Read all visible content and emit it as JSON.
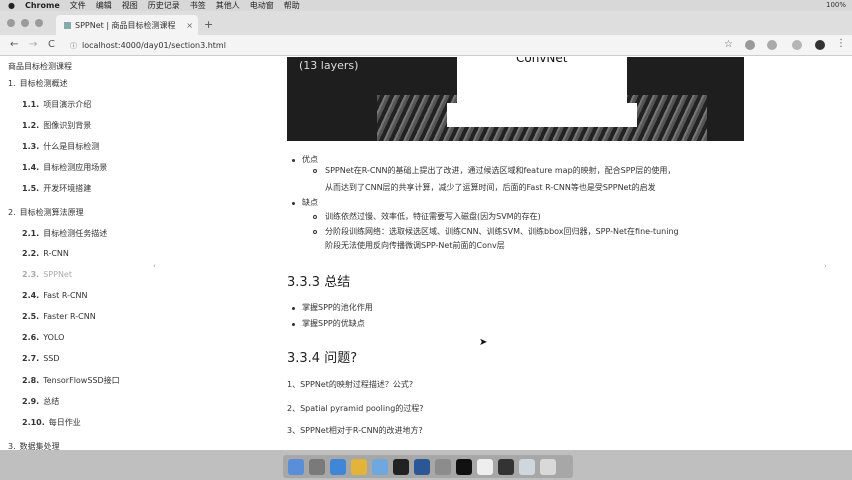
{
  "menubar": {
    "apple": "",
    "items": [
      "Chrome",
      "文件",
      "编辑",
      "视图",
      "历史记录",
      "书签",
      "其他人",
      "电动窗",
      "帮助"
    ],
    "right": [
      "100%"
    ]
  },
  "tab": {
    "title": "SPPNet | 商品目标检测课程",
    "close": "×",
    "new": "+"
  },
  "address": {
    "back": "←",
    "forward": "→",
    "reload": "C",
    "url": "localhost:4000/day01/section3.html",
    "lock": "ⓘ",
    "star": "☆"
  },
  "sidebar": {
    "title": "商品目标检测课程",
    "items": [
      {
        "level": 1,
        "num": "1.",
        "label": "目标检测概述",
        "active": false
      },
      {
        "level": 2,
        "num": "1.1.",
        "label": "项目演示介绍",
        "active": false
      },
      {
        "level": 2,
        "num": "1.2.",
        "label": "图像识别背景",
        "active": false
      },
      {
        "level": 2,
        "num": "1.3.",
        "label": "什么是目标检测",
        "active": false
      },
      {
        "level": 2,
        "num": "1.4.",
        "label": "目标检测应用场景",
        "active": false
      },
      {
        "level": 2,
        "num": "1.5.",
        "label": "开发环境搭建",
        "active": false
      },
      {
        "level": 1,
        "num": "2.",
        "label": "目标检测算法原理",
        "active": false
      },
      {
        "level": 2,
        "num": "2.1.",
        "label": "目标检测任务描述",
        "active": false
      },
      {
        "level": 2,
        "num": "2.2.",
        "label": "R-CNN",
        "active": false
      },
      {
        "level": 2,
        "num": "2.3.",
        "label": "SPPNet",
        "active": true
      },
      {
        "level": 2,
        "num": "2.4.",
        "label": "Fast R-CNN",
        "active": false
      },
      {
        "level": 2,
        "num": "2.5.",
        "label": "Faster R-CNN",
        "active": false
      },
      {
        "level": 2,
        "num": "2.6.",
        "label": "YOLO",
        "active": false
      },
      {
        "level": 2,
        "num": "2.7.",
        "label": "SSD",
        "active": false
      },
      {
        "level": 2,
        "num": "2.8.",
        "label": "TensorFlowSSD接口",
        "active": false
      },
      {
        "level": 2,
        "num": "2.9.",
        "label": "总结",
        "active": false
      },
      {
        "level": 2,
        "num": "2.10.",
        "label": "每日作业",
        "active": false
      },
      {
        "level": 1,
        "num": "3.",
        "label": "数据集处理",
        "active": false
      }
    ]
  },
  "figure": {
    "layers": "(13 layers)",
    "convnet": "ConvNet"
  },
  "content": {
    "pros_label": "优点",
    "pros_line1": "SPPNet在R-CNN的基础上提出了改进，通过候选区域和feature map的映射，配合SPP层的使用，",
    "pros_line2": "从而达到了CNN层的共享计算，减少了运算时间，后面的Fast R-CNN等也是受SPPNet的启发",
    "cons_label": "缺点",
    "cons_1": "训练依然过慢、效率低，特征需要写入磁盘(因为SVM的存在)",
    "cons_2_line1": "分阶段训练网络：选取候选区域、训练CNN、训练SVM、训练bbox回归器，SPP-Net在fine-tuning",
    "cons_2_line2": "阶段无法使用反向传播微调SPP-Net前面的Conv层",
    "summary_heading": "3.3.3 总结",
    "summary_1": "掌握SPP的池化作用",
    "summary_2": "掌握SPP的优缺点",
    "questions_heading": "3.3.4 问题?",
    "q1": "1、SPPNet的映射过程描述？公式?",
    "q2": "2、Spatial pyramid pooling的过程?",
    "q3": "3、SPPNet相对于R-CNN的改进地方?"
  },
  "page_nav": {
    "prev": "‹",
    "next": "›"
  },
  "dock": {
    "icons": [
      "finder-icon",
      "launchpad-icon",
      "safari-icon",
      "chrome-icon",
      "folder-icon",
      "pycharm-icon",
      "word-icon",
      "settings-icon",
      "terminal-icon",
      "typora-icon",
      "obs-icon",
      "preview-icon",
      "trash-icon"
    ]
  }
}
